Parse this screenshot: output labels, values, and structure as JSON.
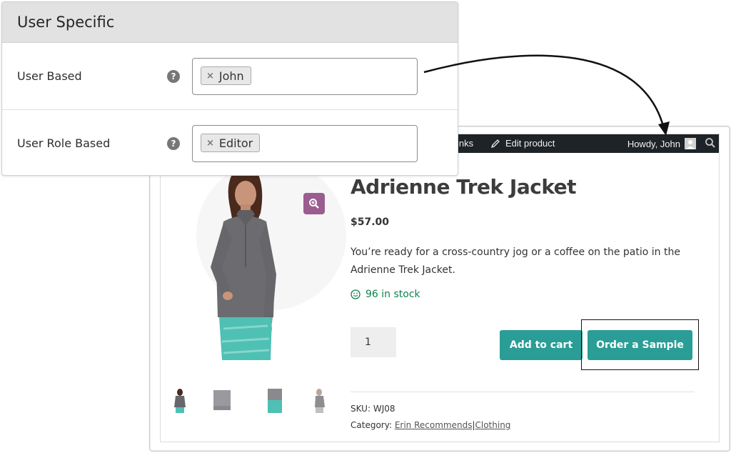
{
  "settings": {
    "title": "User Specific",
    "rows": [
      {
        "label": "User Based",
        "help": "?",
        "tag": "John",
        "remove": "×"
      },
      {
        "label": "User Role Based",
        "help": "?",
        "tag": "Editor",
        "remove": "×"
      }
    ]
  },
  "admin_bar": {
    "links": "inks",
    "edit_product": "Edit product",
    "howdy": "Howdy, John"
  },
  "product": {
    "title": "Adrienne Trek Jacket",
    "price": "$57.00",
    "description": "You’re ready for a cross-country jog or a coffee on the patio in the Adrienne Trek Jacket.",
    "stock": "96 in stock",
    "quantity": "1",
    "add_to_cart": "Add to cart",
    "order_sample": "Order a Sample",
    "sku_label": "SKU:",
    "sku": "WJ08",
    "category_label": "Category:",
    "categories": [
      "Erin Recommends",
      "Clothing"
    ],
    "category_separator": "|"
  },
  "colors": {
    "accent": "#2a9d96",
    "zoom": "#9b5c8f",
    "stock": "#0f834d",
    "admin_bar": "#1d2327"
  }
}
